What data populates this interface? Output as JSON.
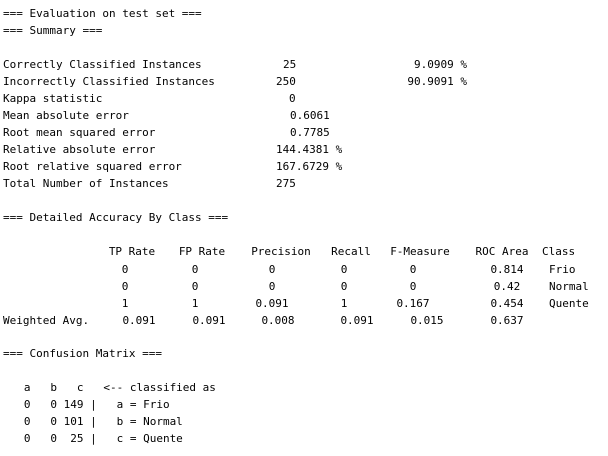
{
  "header": {
    "title": "=== Evaluation on test set ===",
    "summary_title": "=== Summary ==="
  },
  "summary": [
    {
      "label": "Correctly Classified Instances",
      "value": "25",
      "pct": "9.0909 %"
    },
    {
      "label": "Incorrectly Classified Instances",
      "value": "250",
      "pct": "90.9091 %"
    },
    {
      "label": "Kappa statistic",
      "value": "0",
      "pct": ""
    },
    {
      "label": "Mean absolute error",
      "value": "0.6061",
      "pct": ""
    },
    {
      "label": "Root mean squared error",
      "value": "0.7785",
      "pct": ""
    },
    {
      "label": "Relative absolute error",
      "value": "144.4381 %",
      "pct": ""
    },
    {
      "label": "Root relative squared error",
      "value": "167.6729 %",
      "pct": ""
    },
    {
      "label": "Total Number of Instances",
      "value": "275",
      "pct": ""
    }
  ],
  "accuracy": {
    "title": "=== Detailed Accuracy By Class ===",
    "headers": [
      "TP Rate",
      "FP Rate",
      "Precision",
      "Recall",
      "F-Measure",
      "ROC Area",
      "Class"
    ],
    "rows": [
      {
        "label": "",
        "cells": [
          "0",
          "0",
          "0",
          "0",
          "0",
          "0.814",
          "Frio"
        ]
      },
      {
        "label": "",
        "cells": [
          "0",
          "0",
          "0",
          "0",
          "0",
          "0.42",
          "Normal"
        ]
      },
      {
        "label": "",
        "cells": [
          "1",
          "1",
          "0.091",
          "1",
          "0.167",
          "0.454",
          "Quente"
        ]
      },
      {
        "label": "Weighted Avg.",
        "cells": [
          "0.091",
          "0.091",
          "0.008",
          "0.091",
          "0.015",
          "0.637",
          ""
        ]
      }
    ]
  },
  "confusion": {
    "title": "=== Confusion Matrix ===",
    "header": "   a   b   c   <-- classified as",
    "rows": [
      "   0   0 149 |   a = Frio",
      "   0   0 101 |   b = Normal",
      "   0   0  25 |   c = Quente"
    ]
  }
}
